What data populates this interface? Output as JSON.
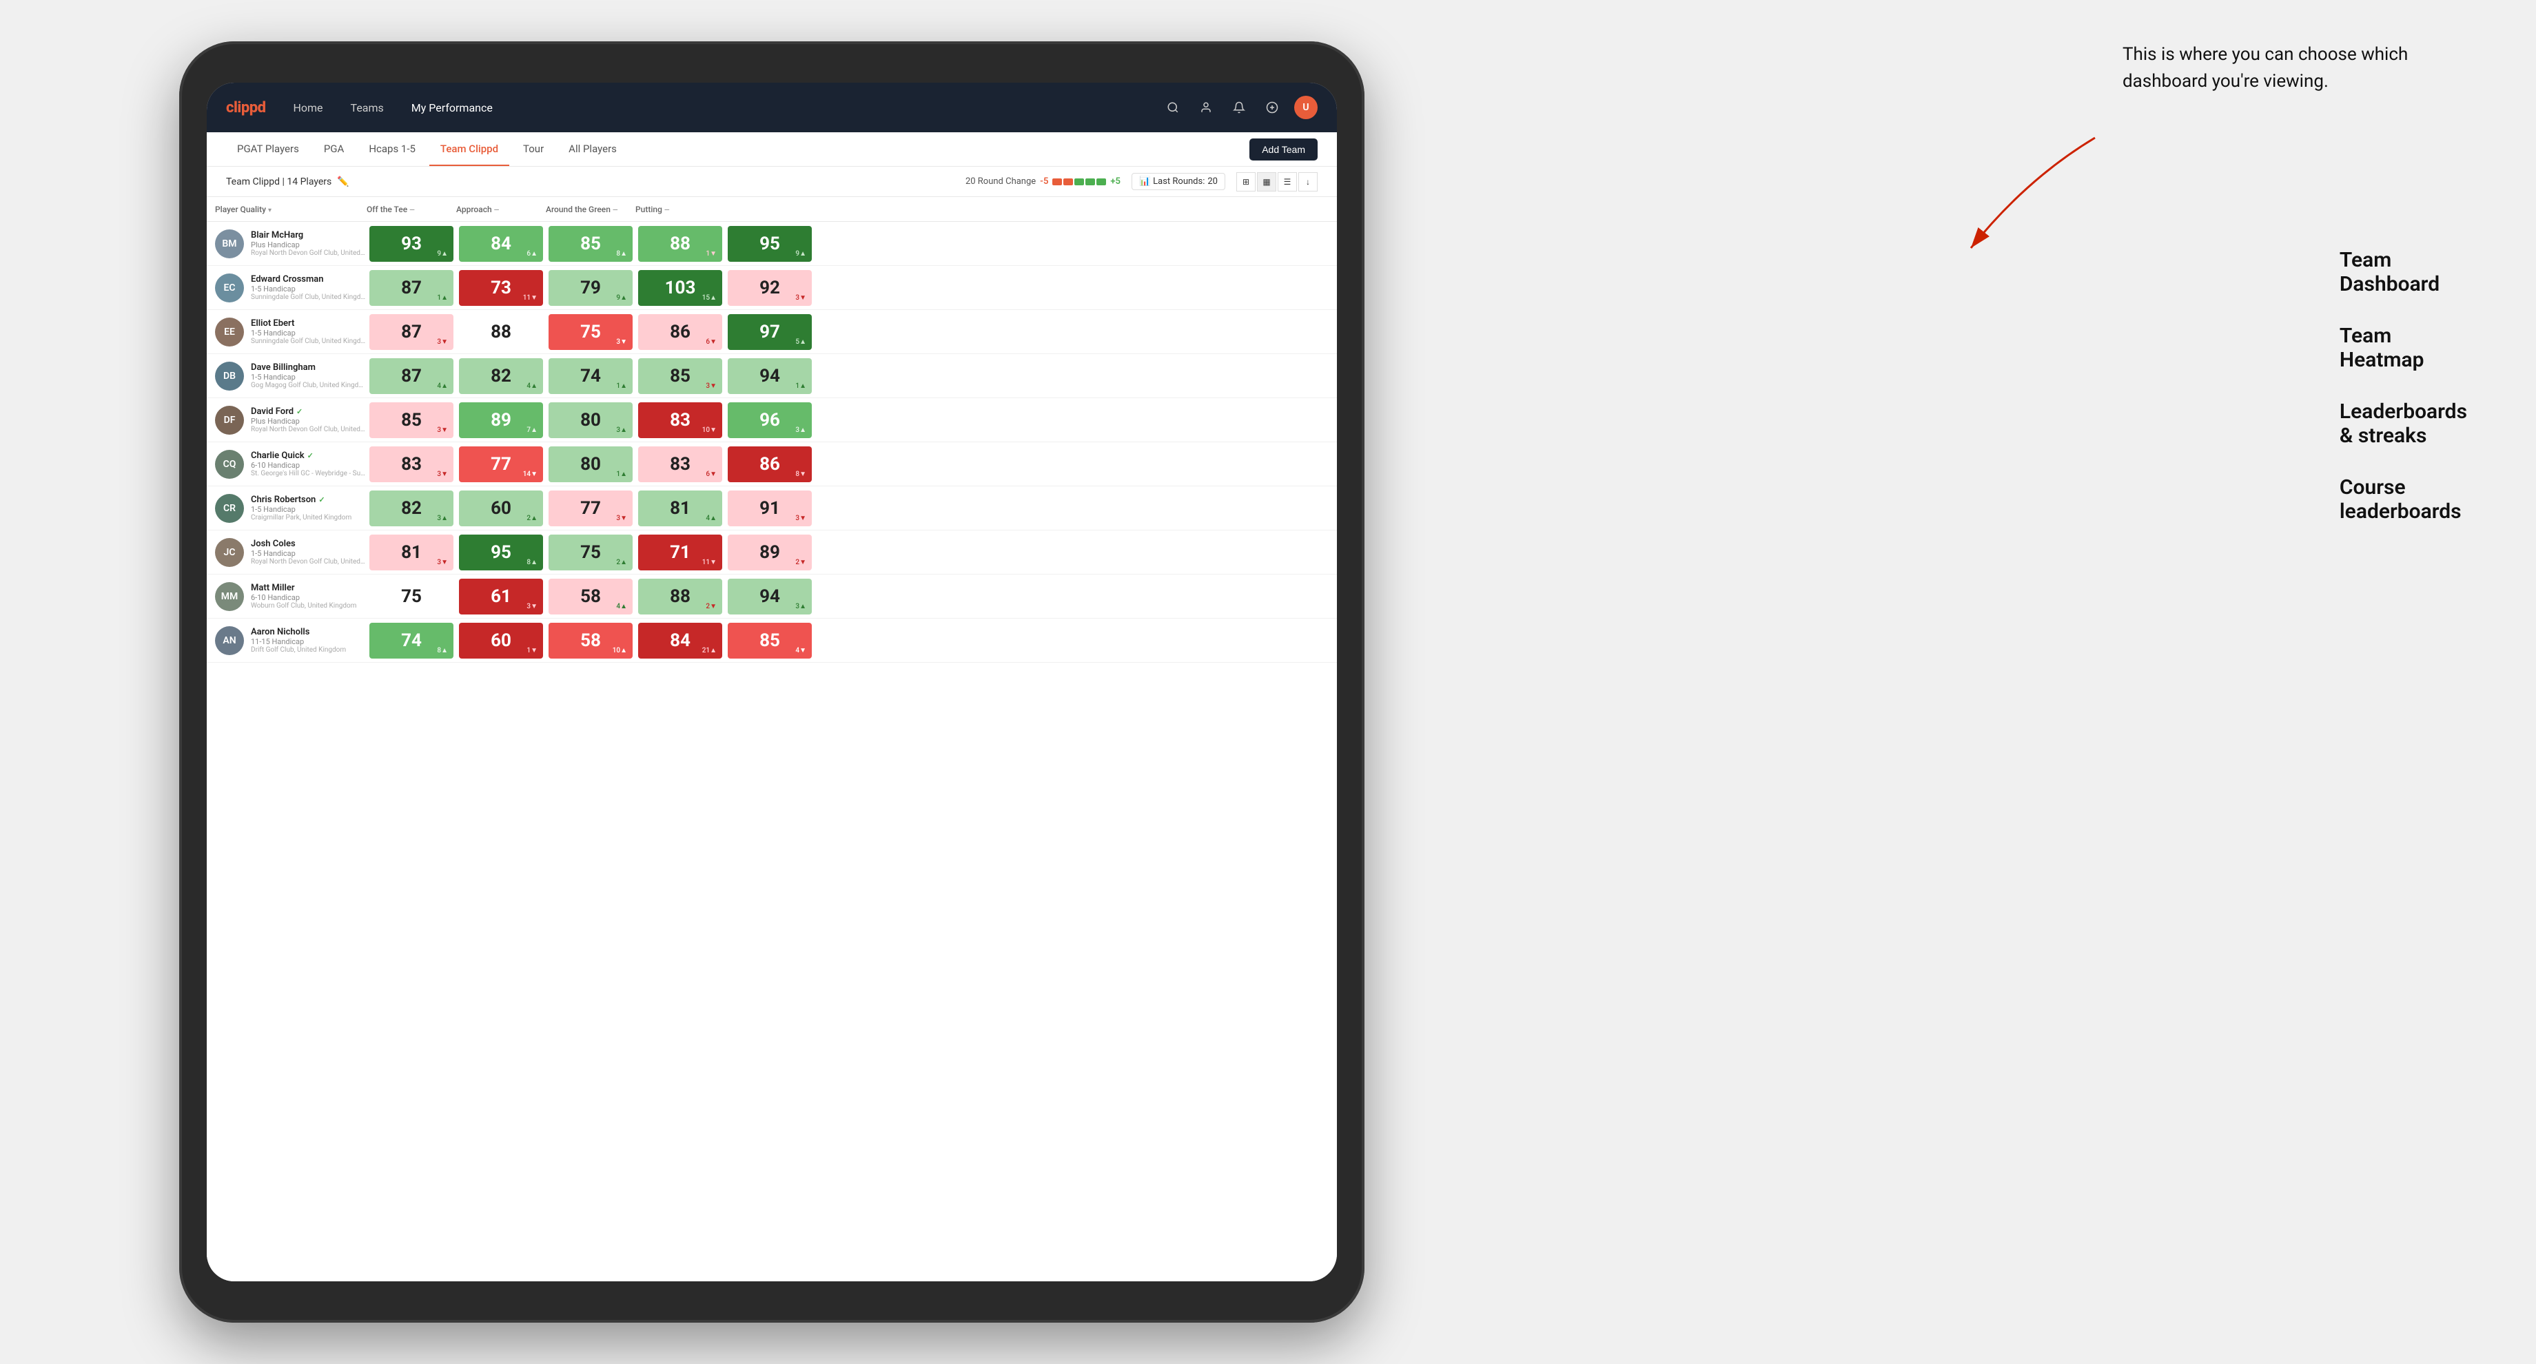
{
  "annotation": {
    "note": "This is where you can choose which dashboard you're viewing.",
    "arrow_direction": "top-right to bottom-left",
    "options": [
      {
        "label": "Team Dashboard"
      },
      {
        "label": "Team Heatmap"
      },
      {
        "label": "Leaderboards & streaks"
      },
      {
        "label": "Course leaderboards"
      }
    ]
  },
  "nav": {
    "logo": "clippd",
    "links": [
      {
        "label": "Home",
        "active": false
      },
      {
        "label": "Teams",
        "active": false
      },
      {
        "label": "My Performance",
        "active": true
      }
    ],
    "icons": [
      "search",
      "person",
      "bell",
      "circle-plus",
      "avatar"
    ]
  },
  "sub_nav": {
    "tabs": [
      {
        "label": "PGAT Players",
        "active": false
      },
      {
        "label": "PGA",
        "active": false
      },
      {
        "label": "Hcaps 1-5",
        "active": false
      },
      {
        "label": "Team Clippd",
        "active": true
      },
      {
        "label": "Tour",
        "active": false
      },
      {
        "label": "All Players",
        "active": false
      }
    ],
    "add_team_label": "Add Team"
  },
  "team_bar": {
    "team_name": "Team Clippd",
    "player_count": "14 Players",
    "round_change_label": "20 Round Change",
    "change_neg": "-5",
    "change_pos": "+5",
    "last_rounds_label": "Last Rounds:",
    "last_rounds_value": "20"
  },
  "table": {
    "headers": [
      {
        "label": "Player Quality",
        "sortable": true
      },
      {
        "label": "Off the Tee",
        "sortable": true
      },
      {
        "label": "Approach",
        "sortable": true
      },
      {
        "label": "Around the Green",
        "sortable": true
      },
      {
        "label": "Putting",
        "sortable": true
      }
    ],
    "players": [
      {
        "name": "Blair McHarg",
        "handicap": "Plus Handicap",
        "club": "Royal North Devon Golf Club, United Kingdom",
        "initials": "BM",
        "avatar_color": "#7b8fa0",
        "scores": [
          {
            "value": "93",
            "change": "9▲",
            "change_dir": "up",
            "bg": "bg-green-strong"
          },
          {
            "value": "84",
            "change": "6▲",
            "change_dir": "up",
            "bg": "bg-green-mid"
          },
          {
            "value": "85",
            "change": "8▲",
            "change_dir": "up",
            "bg": "bg-green-mid"
          },
          {
            "value": "88",
            "change": "1▼",
            "change_dir": "down",
            "bg": "bg-green-mid"
          },
          {
            "value": "95",
            "change": "9▲",
            "change_dir": "up",
            "bg": "bg-green-strong"
          }
        ]
      },
      {
        "name": "Edward Crossman",
        "handicap": "1-5 Handicap",
        "club": "Sunningdale Golf Club, United Kingdom",
        "initials": "EC",
        "avatar_color": "#6b8e9f",
        "scores": [
          {
            "value": "87",
            "change": "1▲",
            "change_dir": "up",
            "bg": "bg-green-light"
          },
          {
            "value": "73",
            "change": "11▼",
            "change_dir": "down",
            "bg": "bg-red-strong"
          },
          {
            "value": "79",
            "change": "9▲",
            "change_dir": "up",
            "bg": "bg-green-light"
          },
          {
            "value": "103",
            "change": "15▲",
            "change_dir": "up",
            "bg": "bg-green-strong"
          },
          {
            "value": "92",
            "change": "3▼",
            "change_dir": "down",
            "bg": "bg-red-light"
          }
        ]
      },
      {
        "name": "Elliot Ebert",
        "handicap": "1-5 Handicap",
        "club": "Sunningdale Golf Club, United Kingdom",
        "initials": "EE",
        "avatar_color": "#8a7060",
        "scores": [
          {
            "value": "87",
            "change": "3▼",
            "change_dir": "down",
            "bg": "bg-red-light"
          },
          {
            "value": "88",
            "change": "",
            "change_dir": "",
            "bg": "bg-white"
          },
          {
            "value": "75",
            "change": "3▼",
            "change_dir": "down",
            "bg": "bg-red-mid"
          },
          {
            "value": "86",
            "change": "6▼",
            "change_dir": "down",
            "bg": "bg-red-light"
          },
          {
            "value": "97",
            "change": "5▲",
            "change_dir": "up",
            "bg": "bg-green-strong"
          }
        ]
      },
      {
        "name": "Dave Billingham",
        "handicap": "1-5 Handicap",
        "club": "Gog Magog Golf Club, United Kingdom",
        "initials": "DB",
        "avatar_color": "#5a7a8a",
        "scores": [
          {
            "value": "87",
            "change": "4▲",
            "change_dir": "up",
            "bg": "bg-green-light"
          },
          {
            "value": "82",
            "change": "4▲",
            "change_dir": "up",
            "bg": "bg-green-light"
          },
          {
            "value": "74",
            "change": "1▲",
            "change_dir": "up",
            "bg": "bg-green-light"
          },
          {
            "value": "85",
            "change": "3▼",
            "change_dir": "down",
            "bg": "bg-green-light"
          },
          {
            "value": "94",
            "change": "1▲",
            "change_dir": "up",
            "bg": "bg-green-light"
          }
        ]
      },
      {
        "name": "David Ford",
        "handicap": "Plus Handicap",
        "club": "Royal North Devon Golf Club, United Kingdom",
        "initials": "DF",
        "verified": true,
        "avatar_color": "#7a6555",
        "scores": [
          {
            "value": "85",
            "change": "3▼",
            "change_dir": "down",
            "bg": "bg-red-light"
          },
          {
            "value": "89",
            "change": "7▲",
            "change_dir": "up",
            "bg": "bg-green-mid"
          },
          {
            "value": "80",
            "change": "3▲",
            "change_dir": "up",
            "bg": "bg-green-light"
          },
          {
            "value": "83",
            "change": "10▼",
            "change_dir": "down",
            "bg": "bg-red-strong"
          },
          {
            "value": "96",
            "change": "3▲",
            "change_dir": "up",
            "bg": "bg-green-mid"
          }
        ]
      },
      {
        "name": "Charlie Quick",
        "handicap": "6-10 Handicap",
        "club": "St. George's Hill GC - Weybridge - Surrey, Uni...",
        "initials": "CQ",
        "verified": true,
        "avatar_color": "#6a8070",
        "scores": [
          {
            "value": "83",
            "change": "3▼",
            "change_dir": "down",
            "bg": "bg-red-light"
          },
          {
            "value": "77",
            "change": "14▼",
            "change_dir": "down",
            "bg": "bg-red-mid"
          },
          {
            "value": "80",
            "change": "1▲",
            "change_dir": "up",
            "bg": "bg-green-light"
          },
          {
            "value": "83",
            "change": "6▼",
            "change_dir": "down",
            "bg": "bg-red-light"
          },
          {
            "value": "86",
            "change": "8▼",
            "change_dir": "down",
            "bg": "bg-red-strong"
          }
        ]
      },
      {
        "name": "Chris Robertson",
        "handicap": "1-5 Handicap",
        "club": "Craigmillar Park, United Kingdom",
        "initials": "CR",
        "verified": true,
        "avatar_color": "#557a6a",
        "scores": [
          {
            "value": "82",
            "change": "3▲",
            "change_dir": "up",
            "bg": "bg-green-light"
          },
          {
            "value": "60",
            "change": "2▲",
            "change_dir": "up",
            "bg": "bg-green-light"
          },
          {
            "value": "77",
            "change": "3▼",
            "change_dir": "down",
            "bg": "bg-red-light"
          },
          {
            "value": "81",
            "change": "4▲",
            "change_dir": "up",
            "bg": "bg-green-light"
          },
          {
            "value": "91",
            "change": "3▼",
            "change_dir": "down",
            "bg": "bg-red-light"
          }
        ]
      },
      {
        "name": "Josh Coles",
        "handicap": "1-5 Handicap",
        "club": "Royal North Devon Golf Club, United Kingdom",
        "initials": "JC",
        "avatar_color": "#8a7a6a",
        "scores": [
          {
            "value": "81",
            "change": "3▼",
            "change_dir": "down",
            "bg": "bg-red-light"
          },
          {
            "value": "95",
            "change": "8▲",
            "change_dir": "up",
            "bg": "bg-green-strong"
          },
          {
            "value": "75",
            "change": "2▲",
            "change_dir": "up",
            "bg": "bg-green-light"
          },
          {
            "value": "71",
            "change": "11▼",
            "change_dir": "down",
            "bg": "bg-red-strong"
          },
          {
            "value": "89",
            "change": "2▼",
            "change_dir": "down",
            "bg": "bg-red-light"
          }
        ]
      },
      {
        "name": "Matt Miller",
        "handicap": "6-10 Handicap",
        "club": "Woburn Golf Club, United Kingdom",
        "initials": "MM",
        "avatar_color": "#7a8a7a",
        "scores": [
          {
            "value": "75",
            "change": "",
            "change_dir": "",
            "bg": "bg-white"
          },
          {
            "value": "61",
            "change": "3▼",
            "change_dir": "down",
            "bg": "bg-red-strong"
          },
          {
            "value": "58",
            "change": "4▲",
            "change_dir": "up",
            "bg": "bg-red-light"
          },
          {
            "value": "88",
            "change": "2▼",
            "change_dir": "down",
            "bg": "bg-green-light"
          },
          {
            "value": "94",
            "change": "3▲",
            "change_dir": "up",
            "bg": "bg-green-light"
          }
        ]
      },
      {
        "name": "Aaron Nicholls",
        "handicap": "11-15 Handicap",
        "club": "Drift Golf Club, United Kingdom",
        "initials": "AN",
        "avatar_color": "#6a7a8a",
        "scores": [
          {
            "value": "74",
            "change": "8▲",
            "change_dir": "up",
            "bg": "bg-green-mid"
          },
          {
            "value": "60",
            "change": "1▼",
            "change_dir": "down",
            "bg": "bg-red-strong"
          },
          {
            "value": "58",
            "change": "10▲",
            "change_dir": "up",
            "bg": "bg-red-mid"
          },
          {
            "value": "84",
            "change": "21▲",
            "change_dir": "up",
            "bg": "bg-red-strong"
          },
          {
            "value": "85",
            "change": "4▼",
            "change_dir": "down",
            "bg": "bg-red-mid"
          }
        ]
      }
    ]
  }
}
